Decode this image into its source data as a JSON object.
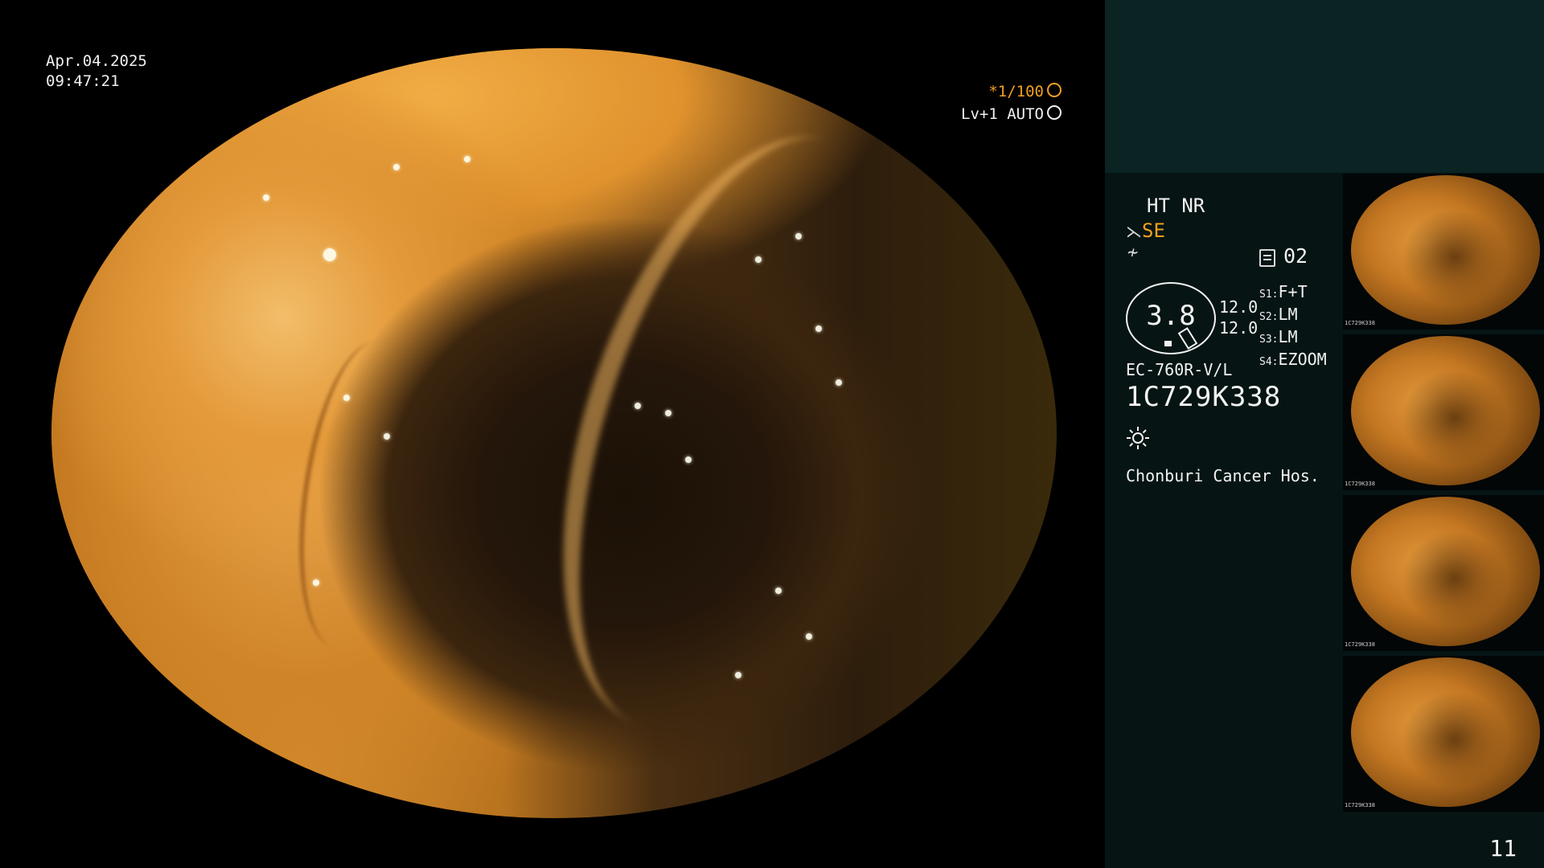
{
  "overlay": {
    "date": "Apr.04.2025",
    "time": "09:47:21",
    "shutter": "*1/100",
    "level": "Lv+1 AUTO"
  },
  "panel": {
    "ht_nr": "HT NR",
    "enhancement": "SE",
    "mode_number": "02",
    "gauge_value": "3.8",
    "gauge_upper": "12.0",
    "gauge_lower": "12.0",
    "switches": [
      {
        "key": "S1:",
        "value": "F+T"
      },
      {
        "key": "S2:",
        "value": "LM"
      },
      {
        "key": "S3:",
        "value": "LM"
      },
      {
        "key": "S4:",
        "value": "EZOOM"
      }
    ],
    "scope_model": "EC-760R-V/L",
    "serial": "1C729K338",
    "hospital": "Chonburi Cancer Hos.",
    "page_number": "11"
  },
  "thumbnails": [
    {
      "serial": "1C729K338"
    },
    {
      "serial": "1C729K338"
    },
    {
      "serial": "1C729K338"
    },
    {
      "serial": "1C729K338"
    }
  ],
  "icons": {
    "shutter": "aperture-icon",
    "level": "iris-icon",
    "mode": "document-icon",
    "light": "sun-icon",
    "enhancement": "scissors-icon",
    "structure": "zigzag-icon"
  },
  "colors": {
    "accent": "#f0a020",
    "panel_top": "#0b2323",
    "panel": "#061414"
  }
}
